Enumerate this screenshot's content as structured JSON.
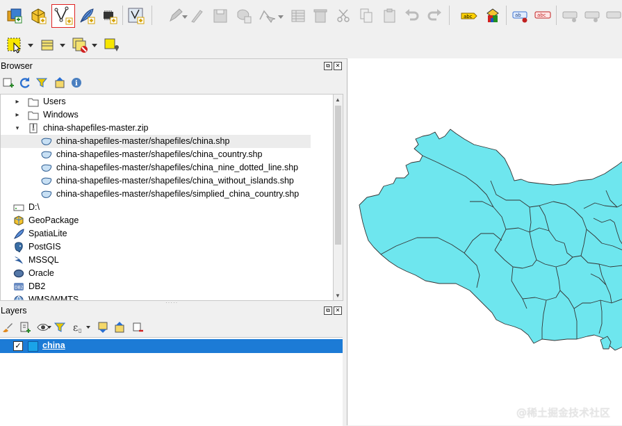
{
  "browser": {
    "title": "Browser",
    "items": [
      {
        "label": "Users",
        "icon": "folder-icon",
        "expand": "collapsed"
      },
      {
        "label": "Windows",
        "icon": "folder-icon",
        "expand": "collapsed"
      },
      {
        "label": "china-shapefiles-master.zip",
        "icon": "zip-archive-icon",
        "expand": "expanded"
      },
      {
        "label": "china-shapefiles-master/shapefiles/china.shp",
        "icon": "polygon-layer-icon",
        "selected": true
      },
      {
        "label": "china-shapefiles-master/shapefiles/china_country.shp",
        "icon": "polygon-layer-icon"
      },
      {
        "label": "china-shapefiles-master/shapefiles/china_nine_dotted_line.shp",
        "icon": "polygon-layer-icon"
      },
      {
        "label": "china-shapefiles-master/shapefiles/china_without_islands.shp",
        "icon": "polygon-layer-icon"
      },
      {
        "label": "china-shapefiles-master/shapefiles/simplied_china_country.shp",
        "icon": "polygon-layer-icon"
      },
      {
        "label": "D:\\",
        "icon": "drive-icon"
      },
      {
        "label": "GeoPackage",
        "icon": "geopackage-icon"
      },
      {
        "label": "SpatiaLite",
        "icon": "spatialite-icon"
      },
      {
        "label": "PostGIS",
        "icon": "postgis-icon"
      },
      {
        "label": "MSSQL",
        "icon": "mssql-icon"
      },
      {
        "label": "Oracle",
        "icon": "oracle-icon"
      },
      {
        "label": "DB2",
        "icon": "db2-icon"
      },
      {
        "label": "WMS/WMTS",
        "icon": "wms-icon"
      }
    ]
  },
  "layers": {
    "title": "Layers",
    "items": [
      {
        "label": "china",
        "checked": true,
        "color": "#1aa3e8"
      }
    ]
  },
  "panel_buttons": {
    "float": "⧉",
    "close": "✕"
  },
  "map": {
    "fill_color": "#6ee6ee",
    "stroke_color": "#333333"
  },
  "watermark": "@稀土掘金技术社区",
  "colors": {
    "selection": "#1c7bd6",
    "highlight_border": "#e02020"
  }
}
